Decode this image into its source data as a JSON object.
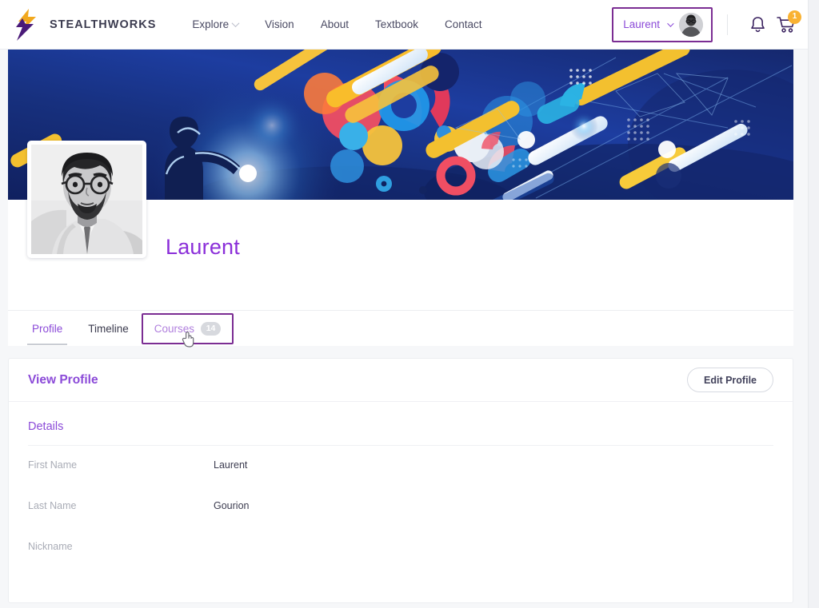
{
  "header": {
    "brand_name": "STEALTHWORKS",
    "brand_logo_icon": "lightning-bolt-logo",
    "nav": [
      {
        "label": "Explore",
        "has_dropdown": true
      },
      {
        "label": "Vision",
        "has_dropdown": false
      },
      {
        "label": "About",
        "has_dropdown": false
      },
      {
        "label": "Textbook",
        "has_dropdown": false
      },
      {
        "label": "Contact",
        "has_dropdown": false
      }
    ],
    "user_menu": {
      "name": "Laurent",
      "chevron_icon": "chevron-down-icon",
      "avatar_icon": "user-avatar",
      "highlight_color": "#7b2d93"
    },
    "notifications_icon": "bell-icon",
    "cart_icon": "shopping-cart-icon",
    "cart_badge_count": "1",
    "cart_badge_color": "#f9b233"
  },
  "cover": {
    "alt": "abstract colorful geometric cover banner with silhouette reaching toward light"
  },
  "profile": {
    "display_name": "Laurent",
    "photo_alt": "profile photo of Laurent",
    "name_color": "#8b2fd9"
  },
  "tabs": [
    {
      "label": "Profile",
      "state": "active",
      "badge": null
    },
    {
      "label": "Timeline",
      "state": "plain",
      "badge": null
    },
    {
      "label": "Courses",
      "state": "link",
      "badge": "14",
      "highlighted": true
    }
  ],
  "cursor_icon": "pointing-hand-cursor",
  "card": {
    "title": "View Profile",
    "edit_label": "Edit Profile",
    "section_title": "Details",
    "rows": [
      {
        "label": "First Name",
        "value": "Laurent"
      },
      {
        "label": "Last Name",
        "value": "Gourion"
      },
      {
        "label": "Nickname",
        "value": ""
      }
    ]
  },
  "colors": {
    "purple": "#8b4ad8",
    "purple_dark": "#7b2d93",
    "orange": "#f9b233",
    "navy": "#13256e"
  }
}
